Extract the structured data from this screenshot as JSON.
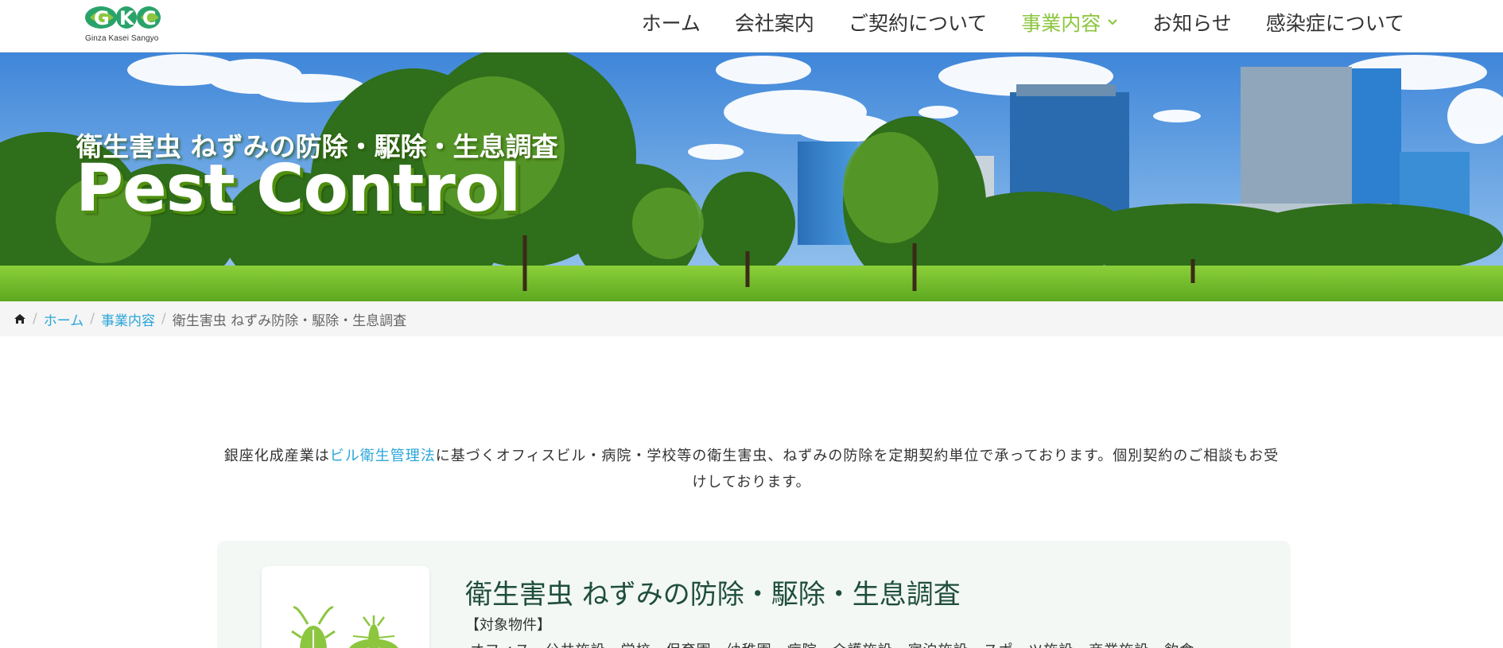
{
  "header": {
    "logo_text": "Ginza Kasei Sangyo",
    "nav": [
      {
        "label": "ホーム"
      },
      {
        "label": "会社案内"
      },
      {
        "label": "ご契約について"
      },
      {
        "label": "事業内容",
        "active": true
      },
      {
        "label": "お知らせ"
      },
      {
        "label": "感染症について"
      }
    ]
  },
  "hero": {
    "subtitle": "衛生害虫  ねずみの防除・駆除・生息調査",
    "title": "Pest Control"
  },
  "breadcrumb": {
    "home_icon": "home-icon",
    "items": [
      "ホーム",
      "事業内容"
    ],
    "current": "衛生害虫 ねずみ防除・駆除・生息調査"
  },
  "intro": {
    "before": "銀座化成産業は",
    "link": "ビル衛生管理法",
    "after": "に基づくオフィスビル・病院・学校等の衛生害虫、ねずみの防除を定期契約単位で承っております。個別契約のご相談もお受けしております。"
  },
  "card": {
    "title": "衛生害虫 ねずみの防除・駆除・生息調査",
    "label": "【対象物件】",
    "text": "オフィス・公共施設・学校・保育園・幼稚園・病院・介護施設・宿泊施設・スポーツ施設・商業施設・飲食"
  },
  "colors": {
    "accent_green": "#8cc63f",
    "link_blue": "#2aa6d9",
    "card_title": "#1f4e3b"
  }
}
